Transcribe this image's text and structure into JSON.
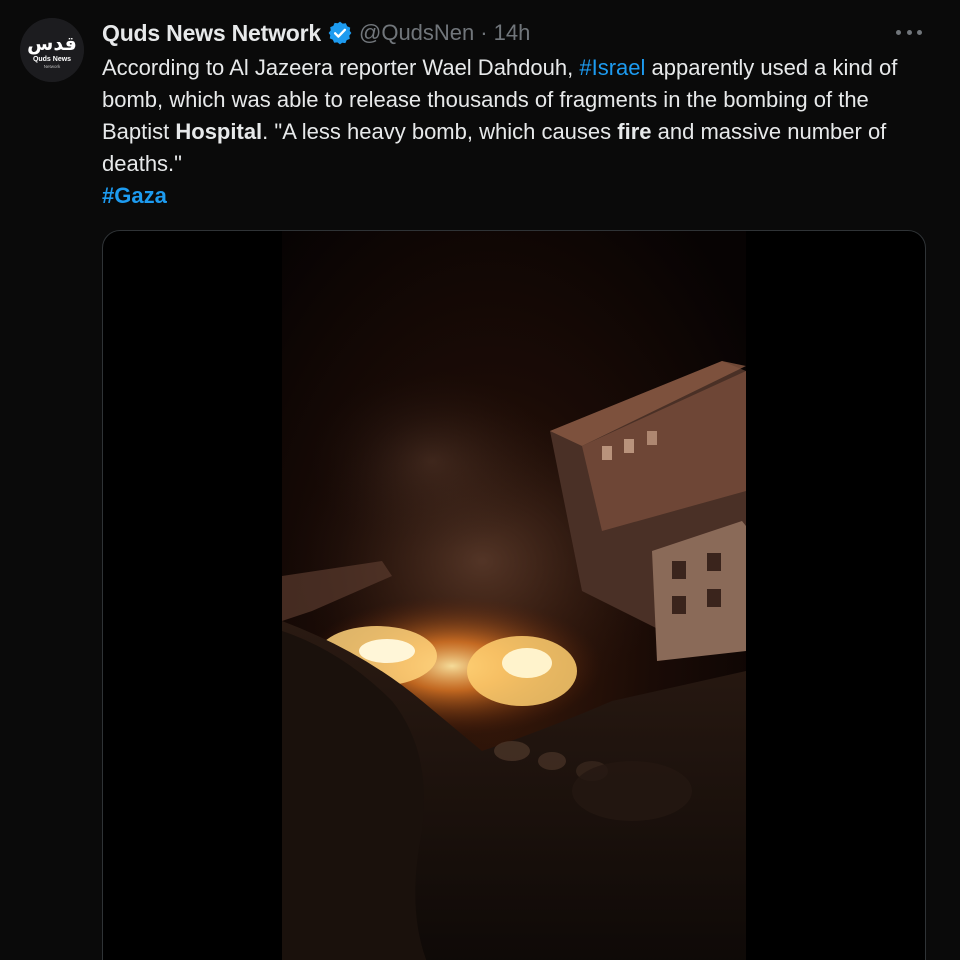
{
  "tweet": {
    "author": {
      "display_name": "Quds News Network",
      "handle": "@QudsNen",
      "separator": "·",
      "time": "14h",
      "avatar_logo_text": "قدس",
      "avatar_caption": "Quds News",
      "avatar_subcaption": "Network",
      "verified_icon": "verified-badge-icon"
    },
    "text": {
      "part1": "According to Al Jazeera reporter Wael Dahdouh, ",
      "hashtag1": "#Israel",
      "part2": " apparently used a kind of bomb, which was able to release thousands of fragments in the bombing of the Baptist ",
      "bold1": "Hospital",
      "part3": ". \"A less heavy bomb, which causes ",
      "bold2": "fire",
      "part4": " and massive number of deaths.\"",
      "hashtag2": "#Gaza"
    },
    "media": {
      "type": "video"
    },
    "more_icon": "more-horizontal-icon"
  },
  "colors": {
    "background": "#0a0a0a",
    "text_primary": "#e7e9ea",
    "text_secondary": "#71767b",
    "link": "#1d9bf0",
    "verified": "#1d9bf0",
    "media_border": "#2f3336"
  }
}
